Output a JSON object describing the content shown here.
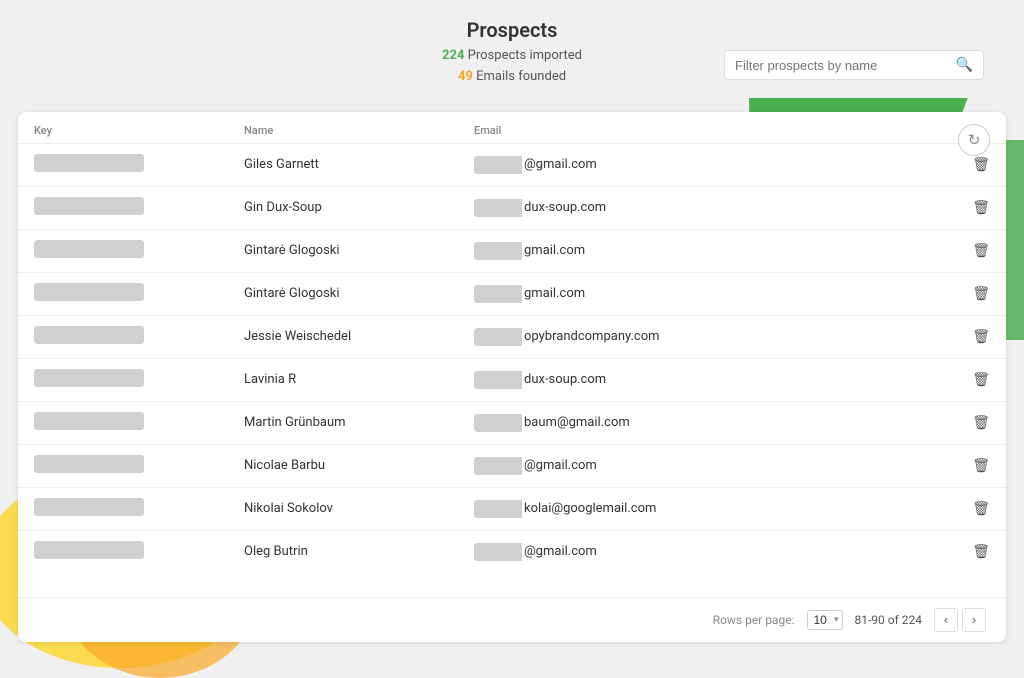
{
  "header": {
    "title": "Prospects",
    "stats": {
      "prospects_count": "224",
      "prospects_label": "Prospects imported",
      "emails_count": "49",
      "emails_label": "Emails founded"
    }
  },
  "search": {
    "placeholder": "Filter prospects by name"
  },
  "table": {
    "columns": {
      "key": "Key",
      "name": "Name",
      "email": "Email"
    },
    "rows": [
      {
        "name": "Giles Garnett",
        "email_visible": "@gmail.com"
      },
      {
        "name": "Gin Dux-Soup",
        "email_visible": "dux-soup.com"
      },
      {
        "name": "Gintarė Glogoski",
        "email_visible": "gmail.com"
      },
      {
        "name": "Gintarė Glogoski",
        "email_visible": "gmail.com"
      },
      {
        "name": "Jessie Weischedel",
        "email_visible": "opybrandcompany.com"
      },
      {
        "name": "Lavinia R",
        "email_visible": "dux-soup.com"
      },
      {
        "name": "Martin Grünbaum",
        "email_visible": "baum@gmail.com"
      },
      {
        "name": "Nicolae Barbu",
        "email_visible": "@gmail.com"
      },
      {
        "name": "Nikolai Sokolov",
        "email_visible": "kolai@googlemail.com"
      },
      {
        "name": "Oleg Butrin",
        "email_visible": "@gmail.com"
      }
    ]
  },
  "pagination": {
    "rows_per_page_label": "Rows per page:",
    "rows_per_page_value": "10",
    "page_range": "81-90 of 224"
  },
  "icons": {
    "search": "🔍",
    "refresh": "↻",
    "delete": "🗑",
    "chevron_down": "▾",
    "prev": "‹",
    "next": "›"
  }
}
